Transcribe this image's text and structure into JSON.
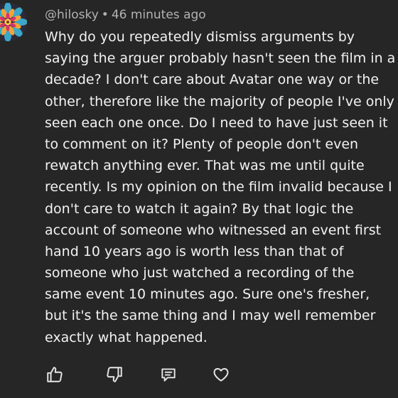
{
  "comment": {
    "username": "@hilosky",
    "separator": "•",
    "timestamp": "46 minutes ago",
    "lines": [
      "Why do you repeatedly dismiss arguments by",
      "saying the arguer probably hasn't seen the film in a",
      "decade? I don't care about Avatar one way or the",
      "other, therefore like the majority of people I've only",
      "seen each one once. Do I need to have just seen it",
      "to comment on it? Plenty of people don't even",
      "rewatch anything ever. That was me until quite",
      "recently. Is my opinion on the film invalid because I",
      "don't care to watch it again? By that logic the",
      "account of someone who witnessed an event first",
      "hand 10 years ago is worth less than that of",
      "someone who just watched a recording of the",
      "same event 10 minutes ago. Sure one's fresher,",
      "but it's the same thing and I may well remember",
      "exactly what happened."
    ]
  },
  "actions": [
    {
      "name": "like-icon"
    },
    {
      "name": "dislike-icon"
    },
    {
      "name": "reply-icon"
    },
    {
      "name": "heart-icon"
    }
  ],
  "colors": {
    "background": "#262626",
    "text": "#f2f2f2",
    "meta_text": "#b3b3b3",
    "icon": "#e6e6e6"
  }
}
